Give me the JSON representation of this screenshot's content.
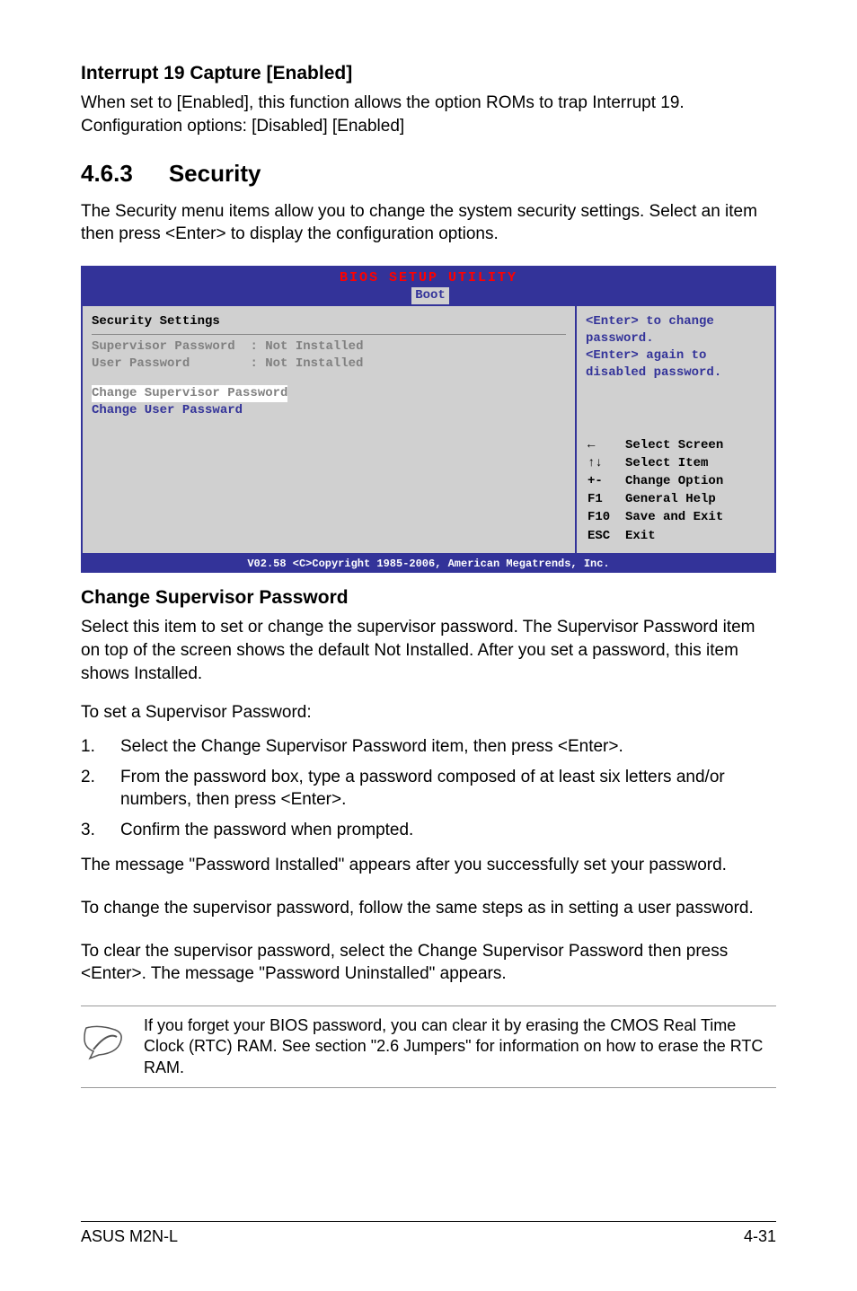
{
  "heading1": "Interrupt 19 Capture [Enabled]",
  "para1": "When set to [Enabled], this function allows the option ROMs to trap Interrupt 19. Configuration options: [Disabled] [Enabled]",
  "section_num": "4.6.3",
  "section_title": "Security",
  "para2": "The Security menu items allow you to change the system security settings. Select an item then press <Enter> to display the configuration options.",
  "bios": {
    "title": "BIOS SETUP UTILITY",
    "tab": "Boot",
    "left_title": "Security Settings",
    "sup_label": "Supervisor Password",
    "sup_value": ": Not Installed",
    "user_label": "User Password",
    "user_value": ": Not Installed",
    "change_sup": "Change Supervisor Password",
    "change_user": "Change User Passward",
    "help1": "<Enter> to change password.",
    "help2": "<Enter> again to disabled password.",
    "keys": {
      "k1": "Select Screen",
      "k2": "Select Item",
      "k3": "Change Option",
      "k4": "General Help",
      "k5": "Save and Exit",
      "k6": "Exit",
      "l3": "+-",
      "l4": "F1",
      "l5": "F10",
      "l6": "ESC"
    },
    "footer": "V02.58 <C>Copyright 1985-2006, American Megatrends, Inc."
  },
  "heading2": "Change Supervisor Password",
  "para3": "Select this item to set or change the supervisor password. The Supervisor Password item on top of the screen shows the default Not Installed. After you set a password, this item shows Installed.",
  "para4": "To set a Supervisor Password:",
  "steps": {
    "s1": "Select the Change Supervisor Password item, then press <Enter>.",
    "s2": "From the password box, type a password composed of at least six letters and/or numbers, then press <Enter>.",
    "s3": "Confirm the password when prompted."
  },
  "para5": "The message \"Password Installed\" appears after you successfully set your password.",
  "para6": "To change the supervisor password, follow the same steps as in setting a user password.",
  "para7": "To clear the supervisor password, select the Change Supervisor Password then press <Enter>. The message \"Password Uninstalled\" appears.",
  "note": "If you forget your BIOS password, you can clear it by erasing the CMOS Real Time Clock (RTC) RAM. See section \"2.6  Jumpers\" for information on how to erase the RTC RAM.",
  "footer_left": "ASUS M2N-L",
  "footer_right": "4-31"
}
